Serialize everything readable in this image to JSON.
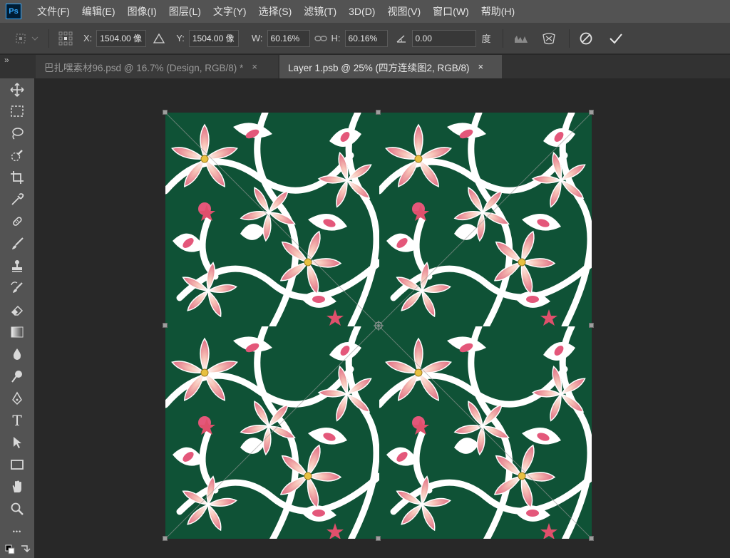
{
  "app": {
    "logo": "Ps"
  },
  "menu": [
    "文件(F)",
    "编辑(E)",
    "图像(I)",
    "图层(L)",
    "文字(Y)",
    "选择(S)",
    "滤镜(T)",
    "3D(D)",
    "视图(V)",
    "窗口(W)",
    "帮助(H)"
  ],
  "options": {
    "x_label": "X:",
    "x_value": "1504.00 像",
    "y_label": "Y:",
    "y_value": "1504.00 像",
    "w_label": "W:",
    "w_value": "60.16%",
    "h_label": "H:",
    "h_value": "60.16%",
    "angle_value": "0.00",
    "angle_unit": "度"
  },
  "tabs": [
    {
      "label": "巴扎嘿素材96.psd @ 16.7% (Design, RGB/8) *",
      "close": "×",
      "active": false
    },
    {
      "label": "Layer 1.psb @ 25% (四方连续图2, RGB/8)",
      "close": "×",
      "active": true
    }
  ],
  "collapse_glyph": "»",
  "canvas": {
    "background": "#0f5236",
    "petal": "#f3a8a6",
    "leaf": "#ffffff"
  },
  "tools": [
    "move-tool",
    "marquee-tool",
    "lasso-tool",
    "quick-select-tool",
    "crop-tool",
    "eyedropper-tool",
    "healing-brush-tool",
    "brush-tool",
    "stamp-tool",
    "history-brush-tool",
    "eraser-tool",
    "gradient-tool",
    "blur-tool",
    "dodge-tool",
    "pen-tool",
    "type-tool",
    "path-select-tool",
    "rectangle-tool",
    "hand-tool",
    "zoom-tool",
    "more-tools"
  ],
  "type_tool_glyph": "T",
  "more_tools_glyph": "•••"
}
